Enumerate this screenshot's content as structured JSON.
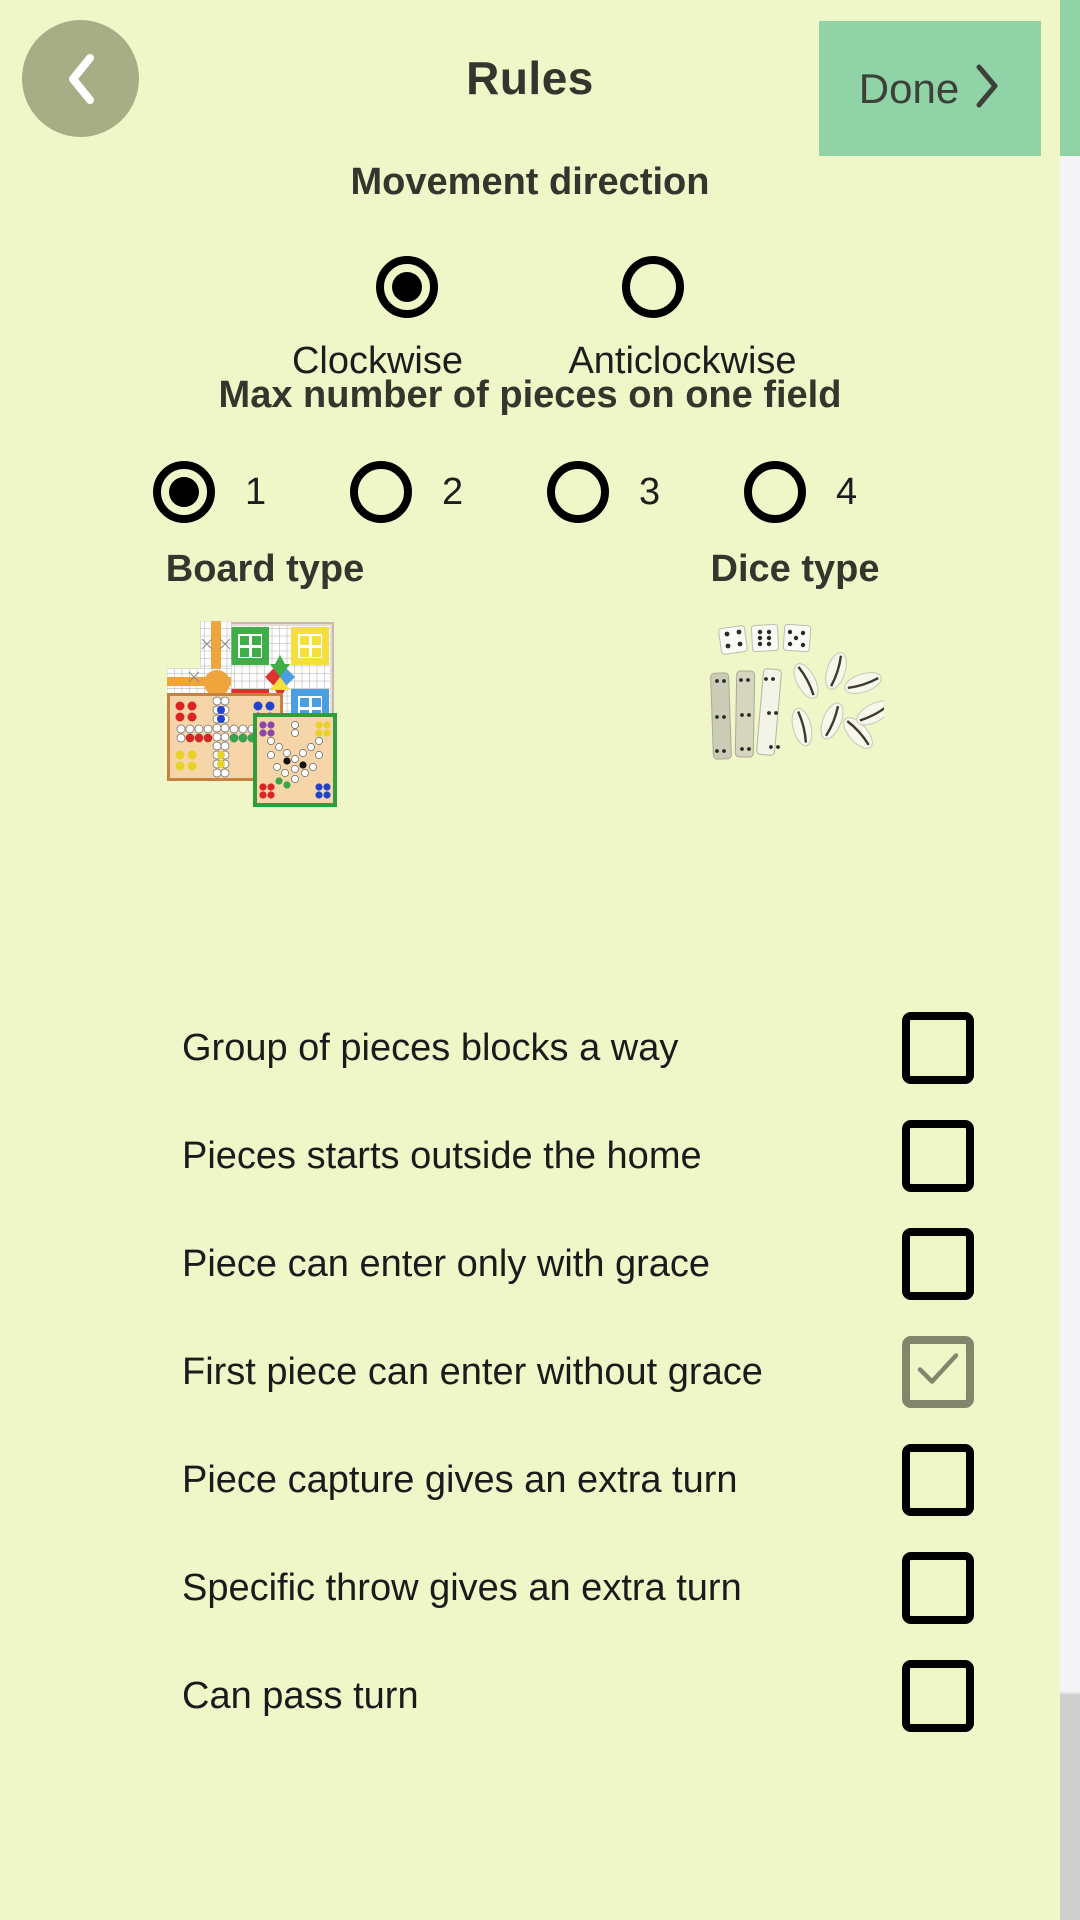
{
  "header": {
    "title": "Rules",
    "back_icon": "chevron-left-icon",
    "done_label": "Done",
    "done_icon": "chevron-right-icon"
  },
  "colors": {
    "background": "#eff6c8",
    "accent_green": "#8fd3a6",
    "back_button": "#a7ae86",
    "title_text": "#33362c",
    "body_text": "#1b1b1b",
    "checked_box": "#81866c",
    "scrollbar_thumb": "#cfcfcf"
  },
  "movement_direction": {
    "title": "Movement direction",
    "options": [
      {
        "label": "Clockwise",
        "selected": true
      },
      {
        "label": "Anticlockwise",
        "selected": false
      }
    ]
  },
  "max_pieces": {
    "title": "Max number of pieces on one field",
    "options": [
      {
        "label": "1",
        "selected": true
      },
      {
        "label": "2",
        "selected": false
      },
      {
        "label": "3",
        "selected": false
      },
      {
        "label": "4",
        "selected": false
      }
    ]
  },
  "pickers": [
    {
      "title": "Board type",
      "image": "ludo-boards-collage-thumbnail"
    },
    {
      "title": "Dice type",
      "image": "dice-cowries-sticks-collage-thumbnail"
    }
  ],
  "rules": [
    {
      "label": "Group of pieces blocks a way",
      "checked": false
    },
    {
      "label": "Pieces starts outside the home",
      "checked": false
    },
    {
      "label": "Piece can enter only with grace",
      "checked": false
    },
    {
      "label": "First piece can enter without grace",
      "checked": true
    },
    {
      "label": "Piece capture gives an extra turn",
      "checked": false
    },
    {
      "label": "Specific throw gives an extra turn",
      "checked": false
    },
    {
      "label": "Can pass turn",
      "checked": false
    }
  ]
}
